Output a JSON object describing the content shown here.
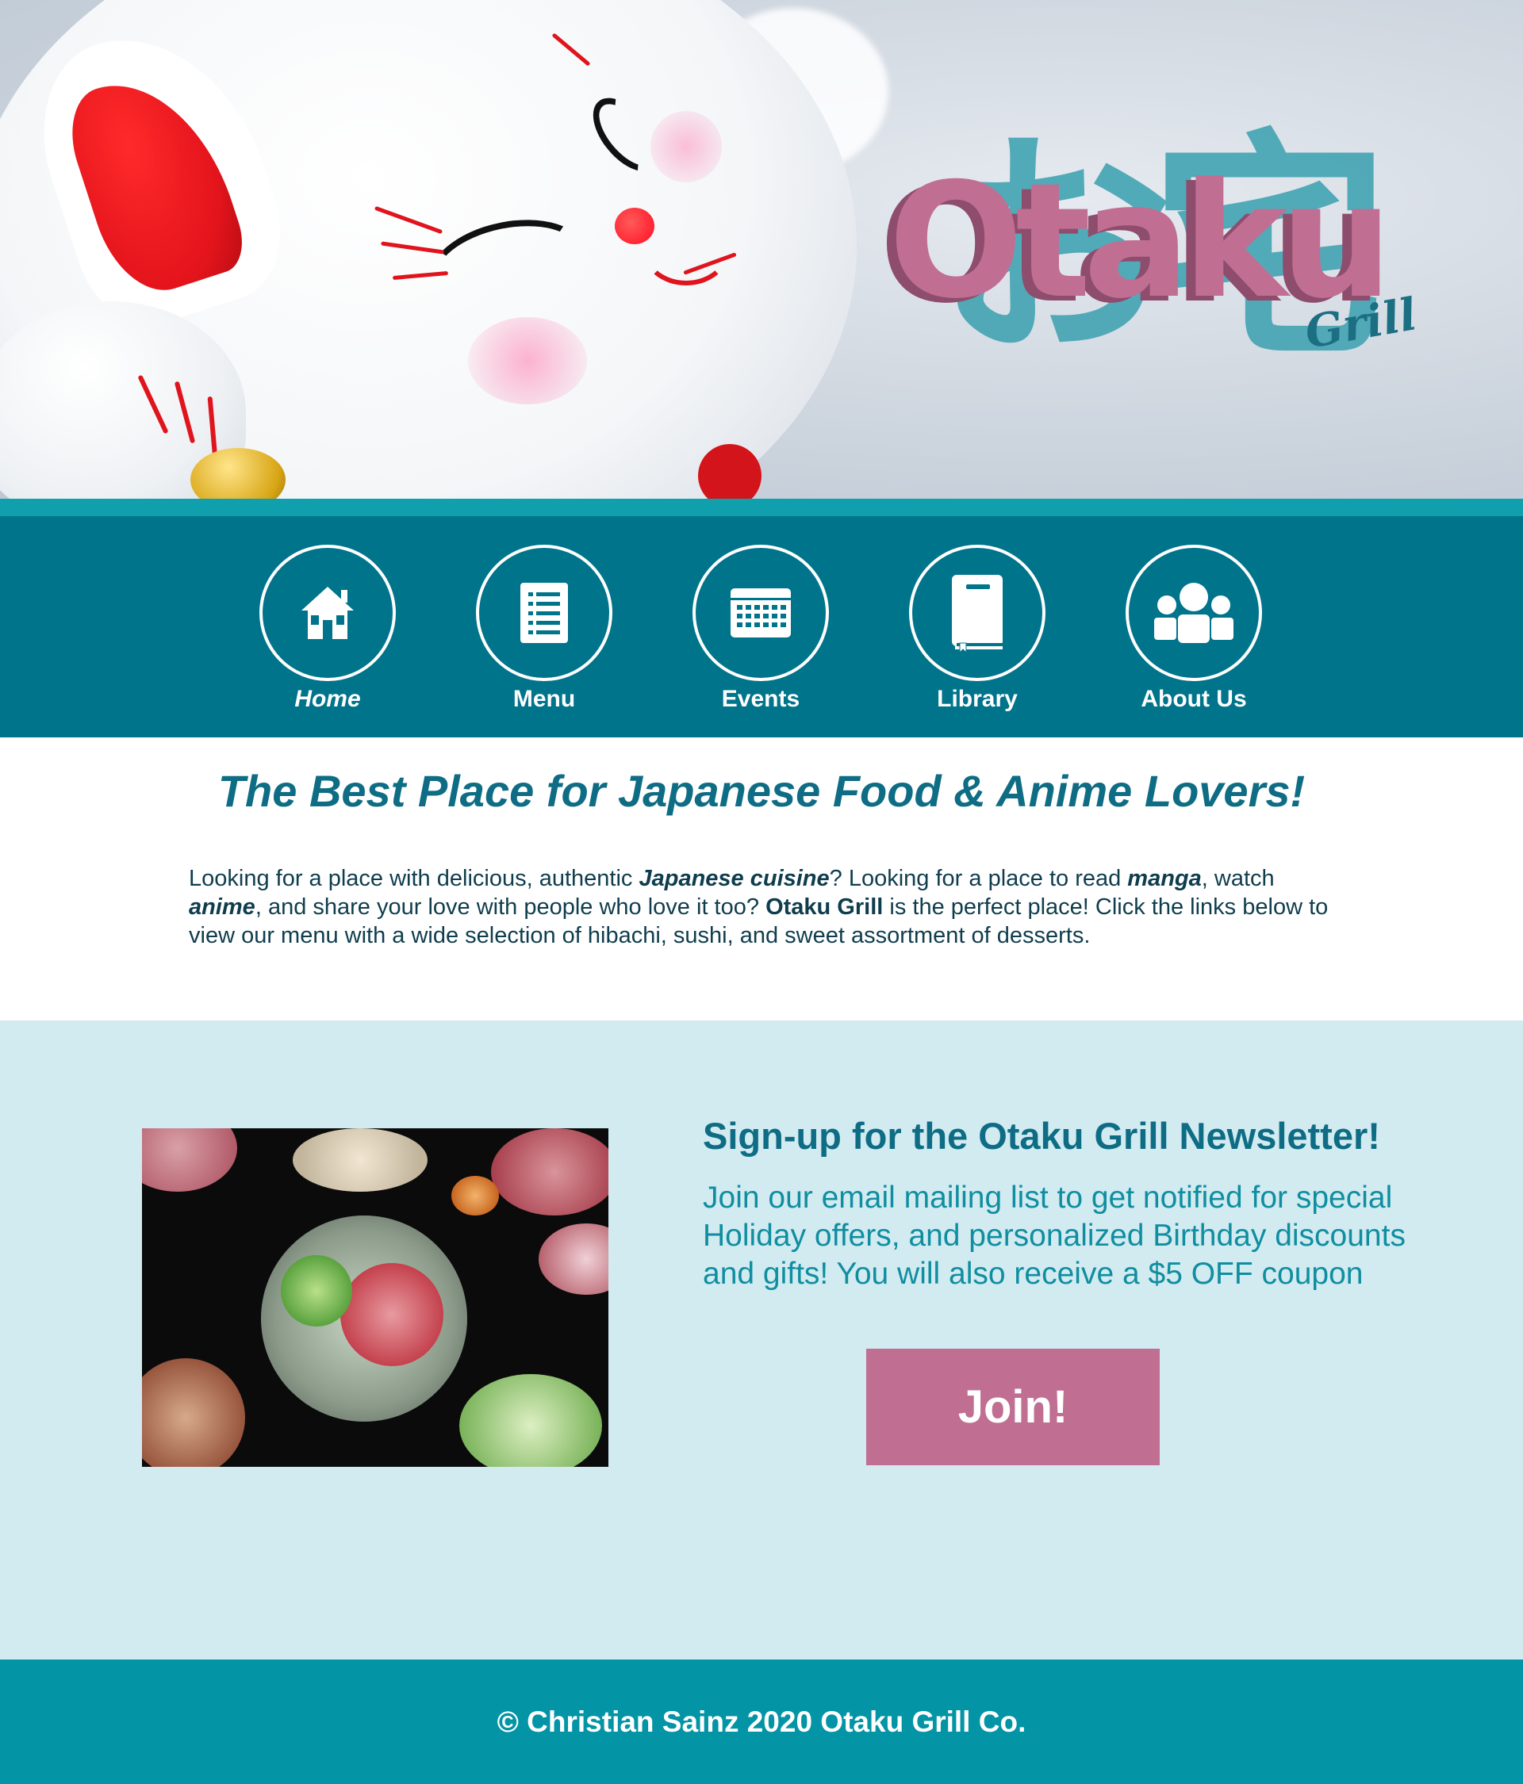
{
  "hero": {
    "logo_kanji": "お宅",
    "logo_word": "Otaku",
    "logo_sub": "Grill"
  },
  "nav": {
    "items": [
      {
        "label": "Home",
        "icon": "home-icon"
      },
      {
        "label": "Menu",
        "icon": "menu-list-icon"
      },
      {
        "label": "Events",
        "icon": "calendar-icon"
      },
      {
        "label": "Library",
        "icon": "book-icon"
      },
      {
        "label": "About Us",
        "icon": "group-icon"
      }
    ]
  },
  "intro": {
    "title": "The Best Place for Japanese Food & Anime Lovers!",
    "p1": "Looking for a place with delicious, authentic ",
    "b1": "Japanese cuisine",
    "p2": "? Looking for a place to read ",
    "b2": "manga",
    "p3": ", watch ",
    "b3": "anime",
    "p4": ", and share your love with people who love it too? ",
    "b4": "Otaku Grill",
    "p5": " is the perfect place! Click the links below to view our menu with a wide selection of hibachi, sushi, and sweet assortment of desserts."
  },
  "newsletter": {
    "title": "Sign-up for the Otaku Grill Newsletter!",
    "text": "Join our email mailing list to get notified for special Holiday offers, and personalized Birthday discounts and gifts! You will also receive a $5 OFF coupon",
    "button": "Join!"
  },
  "footer": {
    "text": "© Christian Sainz 2020 Otaku Grill Co."
  },
  "colors": {
    "nav_bg": "#00748b",
    "accent_pink": "#c06f93",
    "heading_teal": "#0e6d84",
    "newsletter_bg": "#d1ebf1",
    "footer_bg": "#0394a6"
  }
}
